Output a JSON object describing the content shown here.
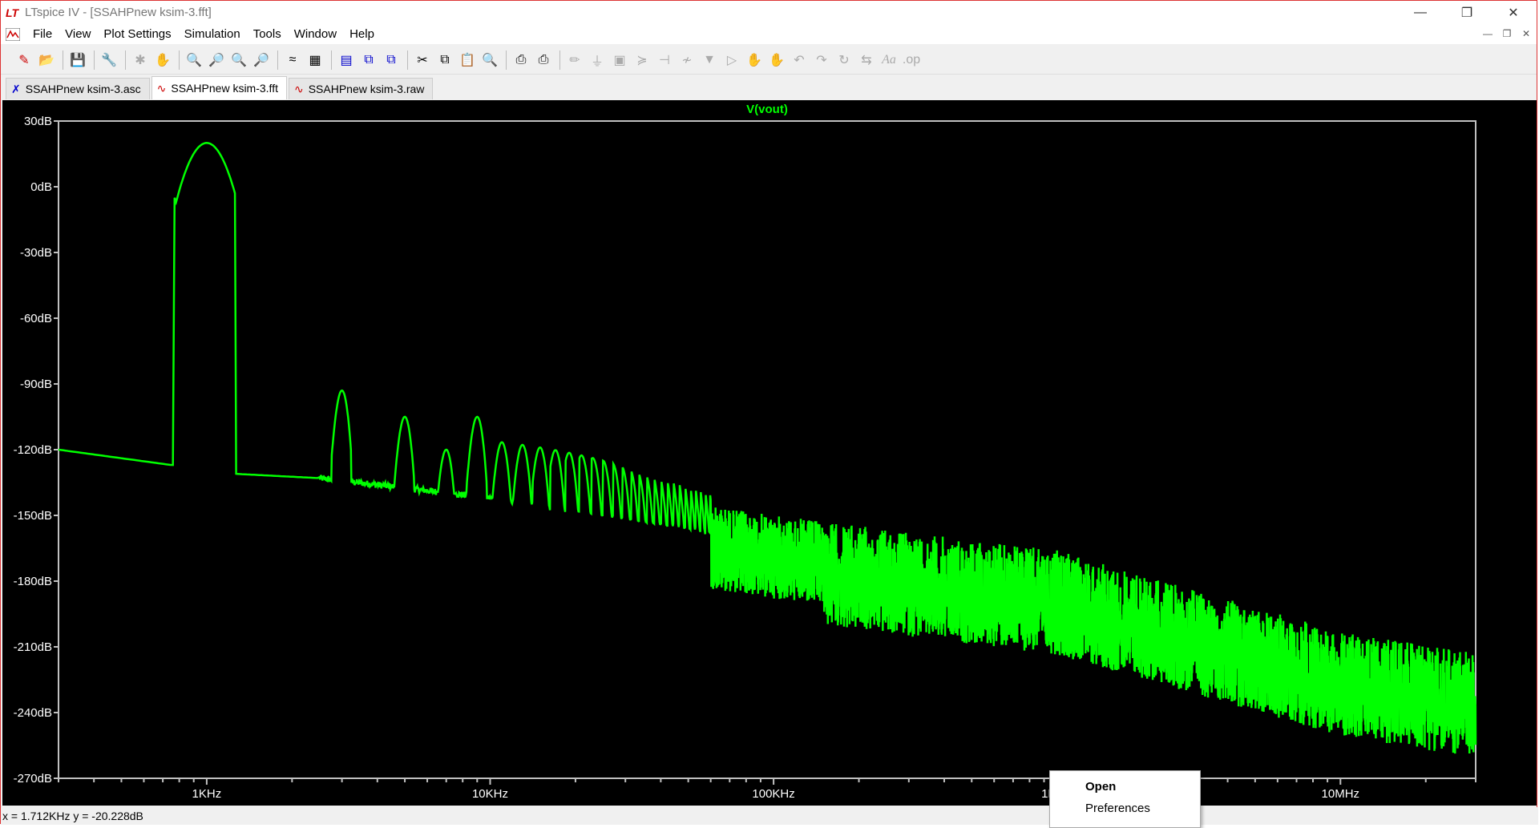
{
  "window": {
    "app_icon": "ltspice-logo-icon",
    "title": "LTspice IV - [SSAHPnew ksim-3.fft]",
    "controls": [
      "minimize-icon",
      "restore-icon",
      "close-icon"
    ]
  },
  "menubar": {
    "items": [
      "File",
      "View",
      "Plot Settings",
      "Simulation",
      "Tools",
      "Window",
      "Help"
    ]
  },
  "toolbar": {
    "icons": [
      "new-schematic-icon",
      "open-icon",
      "save-icon",
      "control-panel-icon",
      "run-icon",
      "halt-icon",
      "zoom-in-icon",
      "zoom-out-icon",
      "zoom-full-icon",
      "zoom-fit-icon",
      "autorange-icon",
      "grid-icon",
      "tile-icon",
      "cascade-icon",
      "horizontal-icon",
      "cut-icon",
      "copy-icon",
      "paste-icon",
      "find-icon",
      "print-setup-icon",
      "print-icon",
      "wire-icon",
      "ground-icon",
      "label-icon",
      "resistor-icon",
      "capacitor-icon",
      "inductor-icon",
      "diode-icon",
      "component-icon",
      "move-icon",
      "drag-icon",
      "undo-icon",
      "redo-icon",
      "rotate-icon",
      "mirror-icon",
      "text-icon",
      "spice-directive-icon"
    ]
  },
  "tabs": [
    {
      "label": "SSAHPnew ksim-3.asc",
      "icon": "schematic-icon",
      "active": false
    },
    {
      "label": "SSAHPnew ksim-3.fft",
      "icon": "waveform-icon",
      "active": true
    },
    {
      "label": "SSAHPnew ksim-3.raw",
      "icon": "waveform-icon",
      "active": false
    }
  ],
  "chart_data": {
    "type": "line",
    "title": "V(vout)",
    "series": [
      {
        "name": "V(vout)",
        "color": "#00ff00"
      }
    ],
    "x_scale": "log",
    "xlim": [
      300,
      30000000
    ],
    "ylim": [
      -270,
      30
    ],
    "x_tick_labels": [
      "1KHz",
      "10KHz",
      "100KHz",
      "1MHz",
      "10MHz"
    ],
    "y_tick_labels": [
      "30dB",
      "0dB",
      "-30dB",
      "-60dB",
      "-90dB",
      "-120dB",
      "-150dB",
      "-180dB",
      "-210dB",
      "-240dB",
      "-270dB"
    ],
    "x_tick_values": [
      1000,
      10000,
      100000,
      1000000,
      10000000
    ],
    "y_tick_values": [
      30,
      0,
      -30,
      -60,
      -90,
      -120,
      -150,
      -180,
      -210,
      -240,
      -270
    ],
    "peaks": [
      {
        "x": 1000,
        "y": 20
      },
      {
        "x": 3000,
        "y": -93
      },
      {
        "x": 5000,
        "y": -105
      },
      {
        "x": 7000,
        "y": -120
      },
      {
        "x": 9000,
        "y": -105
      }
    ],
    "noise_floor": [
      {
        "x": 300,
        "y": -120
      },
      {
        "x": 750,
        "y": -127
      },
      {
        "x": 1250,
        "y": -131
      },
      {
        "x": 2500,
        "y": -133
      },
      {
        "x": 10000,
        "y": -142
      },
      {
        "x": 100000,
        "y": -162
      },
      {
        "x": 1000000,
        "y": -178
      },
      {
        "x": 10000000,
        "y": -215
      },
      {
        "x": 30000000,
        "y": -225
      }
    ],
    "background": "#000000",
    "axis_color": "#c0c0c0",
    "line_color": "#00ff00"
  },
  "statusbar": {
    "cursor": "x = 1.712KHz    y = -20.228dB"
  },
  "context_menu": {
    "items": [
      "Open",
      "Preferences"
    ]
  }
}
